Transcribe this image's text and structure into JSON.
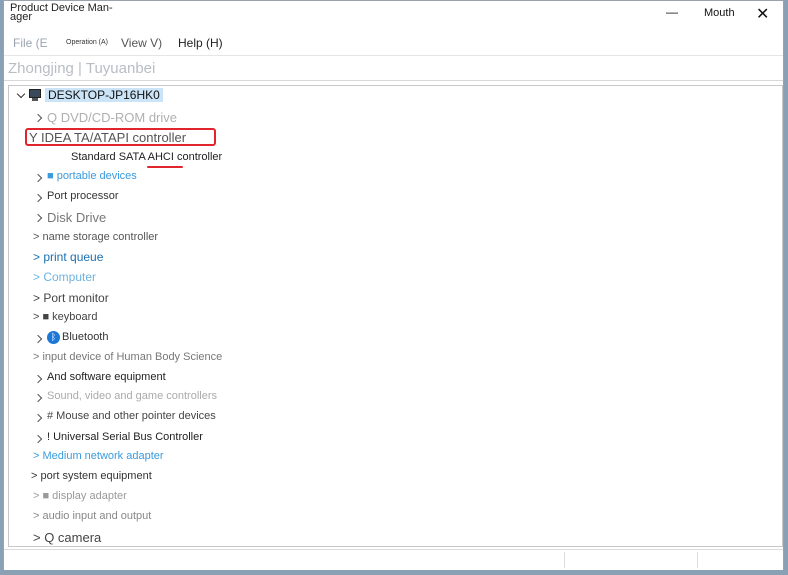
{
  "window": {
    "title": "Product Device Man- ager",
    "minimize_label": "—",
    "right_label": "Mouth",
    "close_label": "✕"
  },
  "menu": {
    "file": "File (E",
    "operation": "Operation (A)",
    "view": "View V)",
    "help": "Help (H)"
  },
  "toolbar": {
    "text": "Zhongjing | Tuyuanbei"
  },
  "tree": {
    "root": "DESKTOP-JP16HK0",
    "items": [
      {
        "label": "Q DVD/CD-ROM drive",
        "color": "#b0b0b0",
        "size": 13
      },
      {
        "label": "Y IDEA TA/ATAPI controller",
        "color": "#555555",
        "size": 13
      },
      {
        "label": "Standard SATA AHCI controller",
        "color": "#222222",
        "size": 11
      },
      {
        "label": "■ portable devices",
        "color": "#3a9bdc",
        "size": 11
      },
      {
        "label": "Port processor",
        "color": "#333333",
        "size": 11
      },
      {
        "label": "Disk Drive",
        "color": "#777777",
        "size": 13
      },
      {
        "label": "> name storage controller",
        "color": "#555555",
        "size": 11
      },
      {
        "label": "> print queue",
        "color": "#1a6fb0",
        "size": 12
      },
      {
        "label": "> Computer",
        "color": "#6cb3e0",
        "size": 12
      },
      {
        "label": "> Port monitor",
        "color": "#444444",
        "size": 12
      },
      {
        "label": "> ■ keyboard",
        "color": "#444444",
        "size": 11
      },
      {
        "label": "Bluetooth",
        "color": "#333333",
        "size": 11
      },
      {
        "label": "> input device of Human Body Science",
        "color": "#777777",
        "size": 11
      },
      {
        "label": "And software equipment",
        "color": "#222222",
        "size": 11
      },
      {
        "label": "Sound, video and game controllers",
        "color": "#aaaaaa",
        "size": 11
      },
      {
        "label": "# Mouse and other pointer devices",
        "color": "#444444",
        "size": 11
      },
      {
        "label": "! Universal Serial Bus Controller",
        "color": "#222222",
        "size": 11
      },
      {
        "label": "> Medium network adapter",
        "color": "#3a9bdc",
        "size": 11
      },
      {
        "label": "> port system equipment",
        "color": "#333333",
        "size": 11
      },
      {
        "label": "> ■ display adapter",
        "color": "#999999",
        "size": 11
      },
      {
        "label": "> audio input and output",
        "color": "#888888",
        "size": 11
      },
      {
        "label": "> Q camera",
        "color": "#444444",
        "size": 13
      }
    ]
  },
  "annotations": {
    "highlight_color": "#e0262c"
  }
}
